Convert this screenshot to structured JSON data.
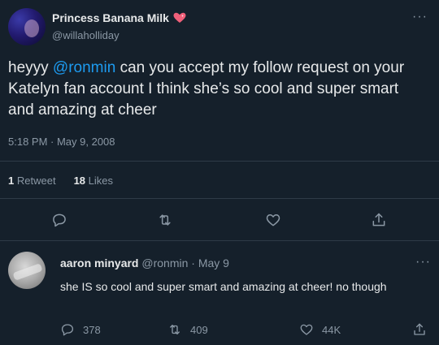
{
  "tweet": {
    "display_name": "Princess Banana Milk",
    "badge_icon": "sparkling-heart-icon",
    "handle": "@willaholliday",
    "text_before": "heyyy ",
    "mention": "@ronmin",
    "text_after": " can you accept my follow request on your Katelyn fan account I think she’s so cool and super smart and amazing at cheer",
    "timestamp": "5:18 PM · May 9, 2008",
    "retweets_count": "1",
    "retweets_label": "Retweet",
    "likes_count": "18",
    "likes_label": "Likes",
    "more_glyph": "···"
  },
  "actions": [
    "reply-icon",
    "retweet-icon",
    "like-icon",
    "share-icon"
  ],
  "reply": {
    "display_name": "aaron minyard",
    "handle_date": "@ronmin · May 9",
    "text": "she IS so cool and super smart and amazing at cheer! no though",
    "replies": "378",
    "retweets": "409",
    "likes": "44K",
    "more_glyph": "···"
  },
  "colors": {
    "background": "#15202b",
    "text": "#e7e9ea",
    "muted": "#8b98a5",
    "accent": "#1d9bf0",
    "heart": "#f0607a"
  }
}
